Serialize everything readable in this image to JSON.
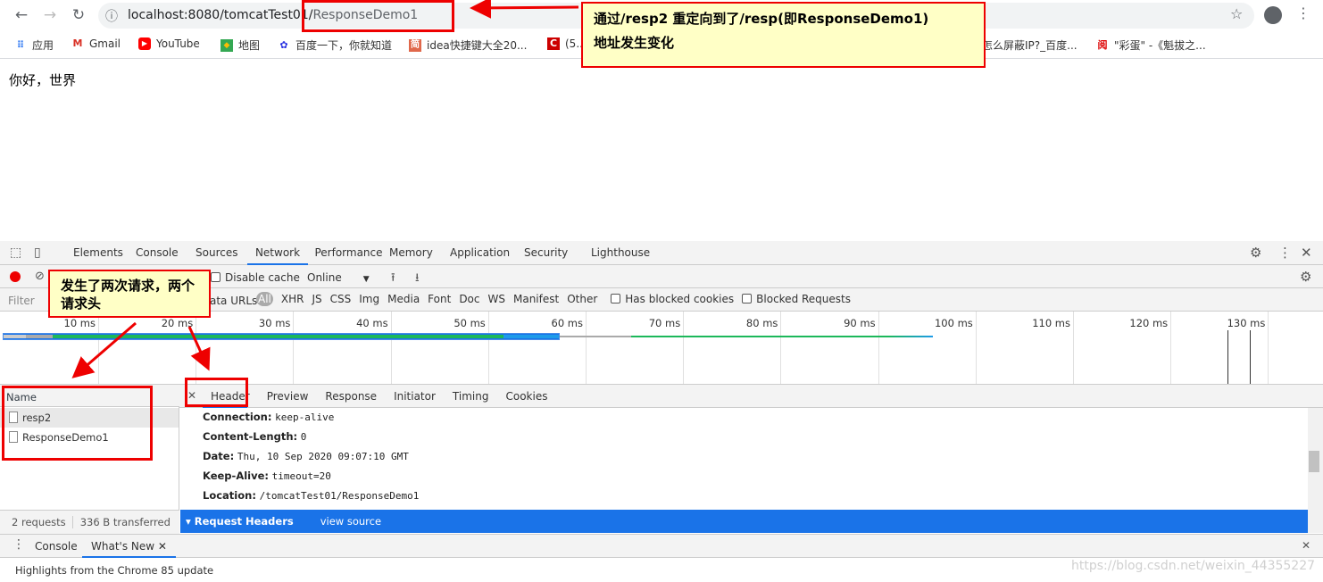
{
  "browser": {
    "url_host": "localhost:8080/tomcatTest01/",
    "url_path": "ResponseDemo1",
    "bookmarks": [
      {
        "label": "应用",
        "icon": "apps-grid-icon"
      },
      {
        "label": "Gmail",
        "icon": "gmail-icon"
      },
      {
        "label": "YouTube",
        "icon": "youtube-icon"
      },
      {
        "label": "地图",
        "icon": "maps-icon"
      },
      {
        "label": "百度一下，你就知道",
        "icon": "baidu-icon"
      },
      {
        "label": "idea快捷键大全20...",
        "icon": "jianshu-icon"
      },
      {
        "label": "(5...",
        "icon": "csdn-icon"
      },
      {
        "label": "怎么屏蔽IP?_百度...",
        "icon": "bookmark-icon"
      },
      {
        "label": "\"彩蛋\" -《魁拔之...",
        "icon": "yuewen-icon"
      }
    ]
  },
  "page": {
    "content": "你好，世界"
  },
  "devtools": {
    "tabs": [
      "Elements",
      "Console",
      "Sources",
      "Network",
      "Performance",
      "Memory",
      "Application",
      "Security",
      "Lighthouse"
    ],
    "active_tab": "Network",
    "toolbar": {
      "disable_cache": "Disable cache",
      "throttle": "Online"
    },
    "filter": {
      "placeholder": "Filter",
      "data_urls": "ata URLs",
      "types": [
        "All",
        "XHR",
        "JS",
        "CSS",
        "Img",
        "Media",
        "Font",
        "Doc",
        "WS",
        "Manifest",
        "Other"
      ],
      "has_blocked": "Has blocked cookies",
      "blocked_requests": "Blocked Requests"
    },
    "timeline_ticks": [
      "10 ms",
      "20 ms",
      "30 ms",
      "40 ms",
      "50 ms",
      "60 ms",
      "70 ms",
      "80 ms",
      "90 ms",
      "100 ms",
      "110 ms",
      "120 ms",
      "130 ms"
    ],
    "name_header": "Name",
    "requests": [
      "resp2",
      "ResponseDemo1"
    ],
    "status": {
      "requests": "2 requests",
      "transferred": "336 B transferred"
    },
    "detail_tabs": [
      "Header",
      "Preview",
      "Response",
      "Initiator",
      "Timing",
      "Cookies"
    ],
    "headers": [
      {
        "k": "Connection:",
        "v": "keep-alive"
      },
      {
        "k": "Content-Length:",
        "v": "0"
      },
      {
        "k": "Date:",
        "v": "Thu, 10 Sep 2020 09:07:10 GMT"
      },
      {
        "k": "Keep-Alive:",
        "v": "timeout=20"
      },
      {
        "k": "Location:",
        "v": "/tomcatTest01/ResponseDemo1"
      }
    ],
    "request_headers": "▾ Request Headers",
    "view_source": "view source",
    "drawer": {
      "tabs": [
        "Console",
        "What's New"
      ],
      "content": "Highlights from the Chrome 85 update"
    }
  },
  "annotations": {
    "note1_line1": "通过/resp2 重定向到了/resp(即ResponseDemo1)",
    "note1_line2": "地址发生变化",
    "note2": "发生了两次请求，两个请求头"
  },
  "watermark": "https://blog.csdn.net/weixin_44355227"
}
